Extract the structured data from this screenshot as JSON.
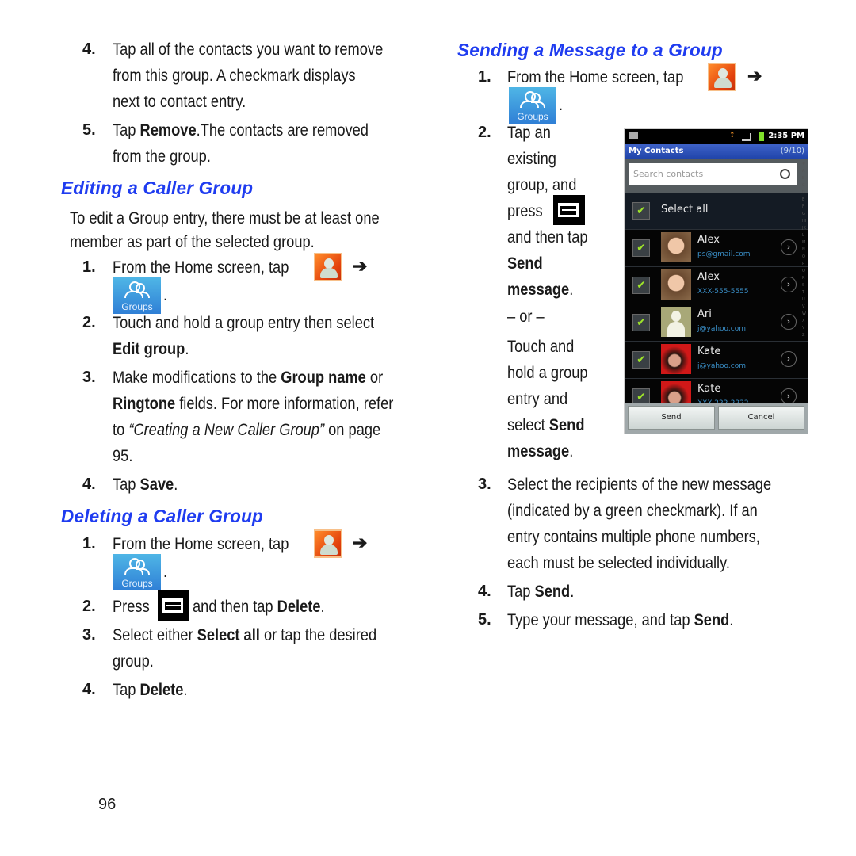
{
  "page_number": "96",
  "left_column": {
    "intro_steps": [
      {
        "num": "4.",
        "lines": [
          "Tap all of the contacts you want to remove",
          "from this group. A checkmark displays",
          "next to contact entry."
        ]
      },
      {
        "num": "5.",
        "pre": "Tap ",
        "bold": "Remove",
        "post": ".The contacts are removed",
        "line2": "from the group."
      }
    ],
    "editing": {
      "heading": "Editing a Caller Group",
      "intro": [
        "To edit a Group entry, there must be at least one",
        "member as part of the selected group."
      ],
      "step1": {
        "num": "1.",
        "text": "From the Home screen, tap",
        "arrow": "➔",
        "period": "."
      },
      "step2": {
        "num": "2.",
        "text": "Touch and hold a group entry then select",
        "bold": "Edit group",
        "post": "."
      },
      "step3": {
        "num": "3.",
        "pre": "Make modifications to the ",
        "bold1": "Group name",
        "mid": " or",
        "bold2": "Ringtone",
        "line2": " fields. For more information, refer",
        "to": "to ",
        "ref": "“Creating a New Caller Group”",
        "onpage": "  on page",
        "page": "95."
      },
      "step4": {
        "num": "4.",
        "pre": "Tap ",
        "bold": "Save",
        "post": "."
      }
    },
    "deleting": {
      "heading": "Deleting a Caller Group",
      "step1": {
        "num": "1.",
        "text": "From the Home screen, tap",
        "arrow": "➔",
        "period": "."
      },
      "step2": {
        "num": "2.",
        "pre": "Press",
        "post": " and then tap ",
        "bold": "Delete",
        "end": "."
      },
      "step3": {
        "num": "3.",
        "pre": "Select either ",
        "bold": "Select all",
        "post": " or tap the desired",
        "line2": "group."
      },
      "step4": {
        "num": "4.",
        "pre": "Tap ",
        "bold": "Delete",
        "post": "."
      }
    }
  },
  "right_column": {
    "heading": "Sending a Message to a Group",
    "step1": {
      "num": "1.",
      "text": "From the Home screen, tap",
      "arrow": "➔",
      "period": "."
    },
    "step2": {
      "num": "2.",
      "lines": [
        "Tap an",
        "existing",
        "group, and",
        "press",
        "and then tap"
      ],
      "bold1": "Send",
      "bold2": "message",
      "period": ".",
      "or": "– or –",
      "alt_lines": [
        "Touch and",
        "hold a group",
        "entry and",
        "select "
      ],
      "alt_bold1": "Send",
      "alt_bold2": "message"
    },
    "step3": {
      "num": "3.",
      "lines": [
        "Select the recipients of the new message",
        "(indicated by a green checkmark). If an",
        "entry contains multiple phone numbers,",
        "each must be selected individually."
      ]
    },
    "step4": {
      "num": "4.",
      "pre": "Tap ",
      "bold": "Send",
      "post": "."
    },
    "step5": {
      "num": "5.",
      "pre": "Type your message, and tap ",
      "bold": "Send",
      "post": "."
    }
  },
  "icons": {
    "groups_label": "Groups"
  },
  "phone": {
    "time": "2:35 PM",
    "title": "My Contacts",
    "count": "(9/10)",
    "search_placeholder": "Search contacts",
    "select_all": "Select all",
    "contacts": [
      {
        "name": "Alex",
        "detail": "ps@gmail.com",
        "checked": true
      },
      {
        "name": "Alex",
        "detail": "XXX-555-5555",
        "checked": true
      },
      {
        "name": "Ari",
        "detail": "j@yahoo.com",
        "checked": true
      },
      {
        "name": "Kate",
        "detail": "j@yahoo.com",
        "checked": true
      },
      {
        "name": "Kate",
        "detail": "XXX-222-2222",
        "checked": true
      }
    ],
    "send_label": "Send",
    "cancel_label": "Cancel",
    "alpha_index": "#ABCDEFGHIJKLMNOPQRSTUVWXYZ",
    "colors": {
      "title_bar": "#2a4fb8",
      "check": "#9ee42a",
      "link": "#3a8fc8"
    }
  },
  "colors": {
    "heading": "#1f3cf0",
    "text": "#1a1a1a"
  }
}
